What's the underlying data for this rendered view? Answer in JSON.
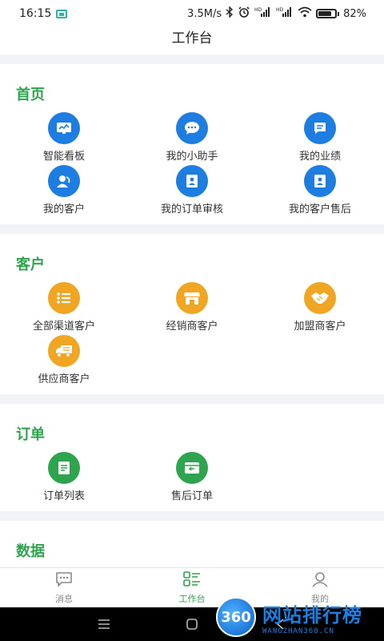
{
  "status_bar": {
    "time": "16:15",
    "network_speed": "3.5M/s",
    "battery_percent": "82%",
    "battery_level": 0.82
  },
  "header": {
    "title": "工作台"
  },
  "sections": [
    {
      "title": "首页",
      "items": [
        {
          "label": "智能看板",
          "icon": "dashboard-icon",
          "color": "#1d7de0"
        },
        {
          "label": "我的小助手",
          "icon": "chat-bubble-icon",
          "color": "#1d7de0"
        },
        {
          "label": "我的业绩",
          "icon": "performance-icon",
          "color": "#1d7de0"
        },
        {
          "label": "我的客户",
          "icon": "customer-icon",
          "color": "#1d7de0"
        },
        {
          "label": "我的订单审核",
          "icon": "order-review-icon",
          "color": "#1d7de0"
        },
        {
          "label": "我的客户售后",
          "icon": "after-sales-icon",
          "color": "#1d7de0"
        }
      ]
    },
    {
      "title": "客户",
      "items": [
        {
          "label": "全部渠道客户",
          "icon": "list-icon",
          "color": "#f0a623"
        },
        {
          "label": "经销商客户",
          "icon": "store-icon",
          "color": "#f0a623"
        },
        {
          "label": "加盟商客户",
          "icon": "handshake-icon",
          "color": "#f0a623"
        },
        {
          "label": "供应商客户",
          "icon": "truck-icon",
          "color": "#f0a623"
        }
      ]
    },
    {
      "title": "订单",
      "items": [
        {
          "label": "订单列表",
          "icon": "order-list-icon",
          "color": "#2ea44f"
        },
        {
          "label": "售后订单",
          "icon": "return-order-icon",
          "color": "#2ea44f"
        }
      ]
    },
    {
      "title": "数据",
      "items": []
    }
  ],
  "tabbar": {
    "tabs": [
      {
        "label": "消息",
        "icon": "message-icon",
        "active": false
      },
      {
        "label": "工作台",
        "icon": "workbench-icon",
        "active": true
      },
      {
        "label": "我的",
        "icon": "profile-icon",
        "active": false
      }
    ]
  },
  "watermark": {
    "logo_text": "360",
    "title": "网站排行榜",
    "subtitle": "WANGZHAN360.CN"
  },
  "colors": {
    "accent_green": "#2ea44f",
    "icon_blue": "#1d7de0",
    "icon_orange": "#f0a623"
  }
}
